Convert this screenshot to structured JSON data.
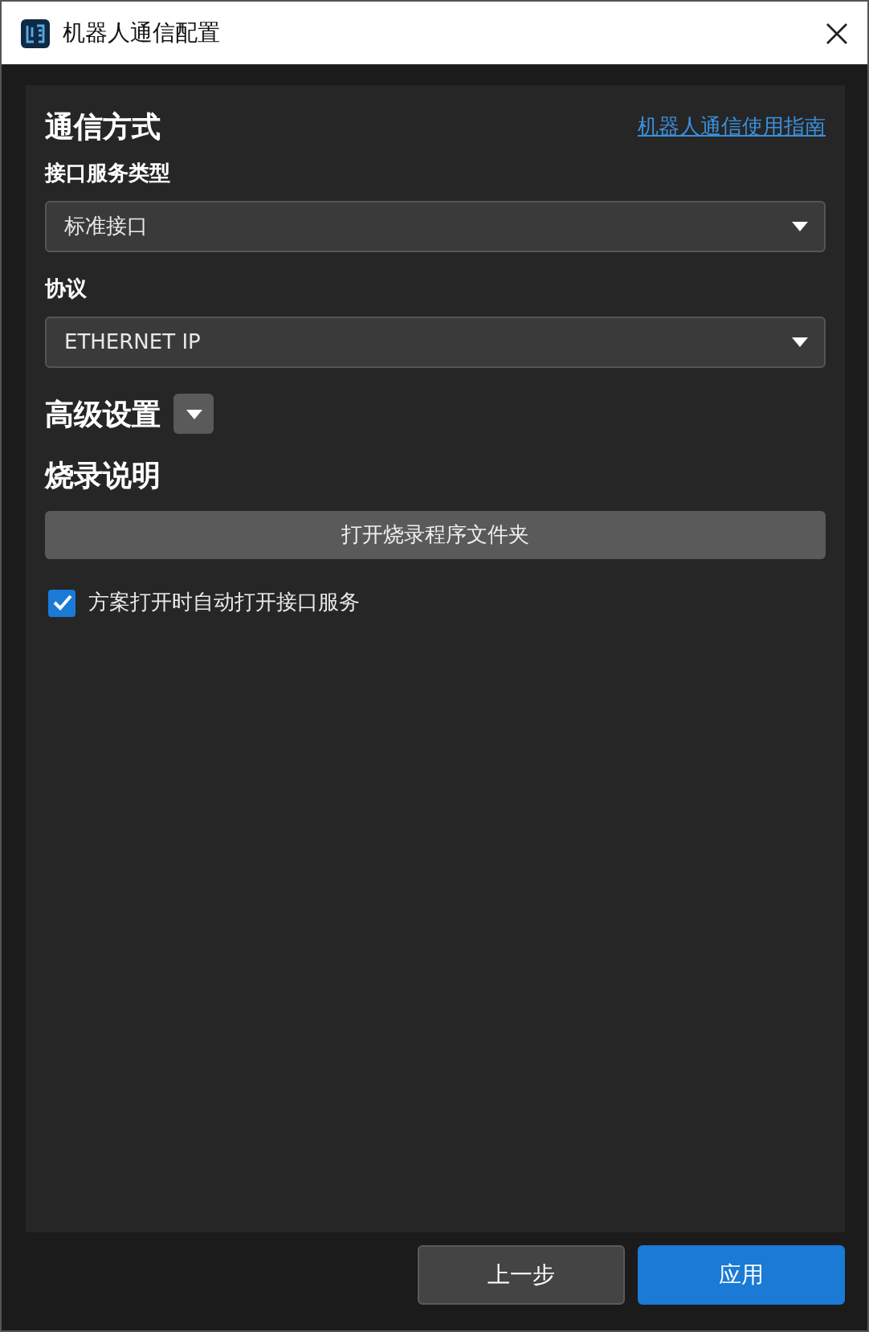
{
  "window": {
    "title": "机器人通信配置"
  },
  "section": {
    "title": "通信方式",
    "link": "机器人通信使用指南"
  },
  "fields": [
    {
      "label": "接口服务类型",
      "value": "标准接口"
    },
    {
      "label": "协议",
      "value": "ETHERNET IP"
    }
  ],
  "advanced": {
    "title": "高级设置",
    "expanded": false
  },
  "burn": {
    "title": "烧录说明",
    "button": "打开烧录程序文件夹"
  },
  "auto_open": {
    "label": "方案打开时自动打开接口服务",
    "checked": true
  },
  "buttons": [
    {
      "label": "上一步",
      "kind": "secondary"
    },
    {
      "label": "应用",
      "kind": "primary"
    }
  ]
}
